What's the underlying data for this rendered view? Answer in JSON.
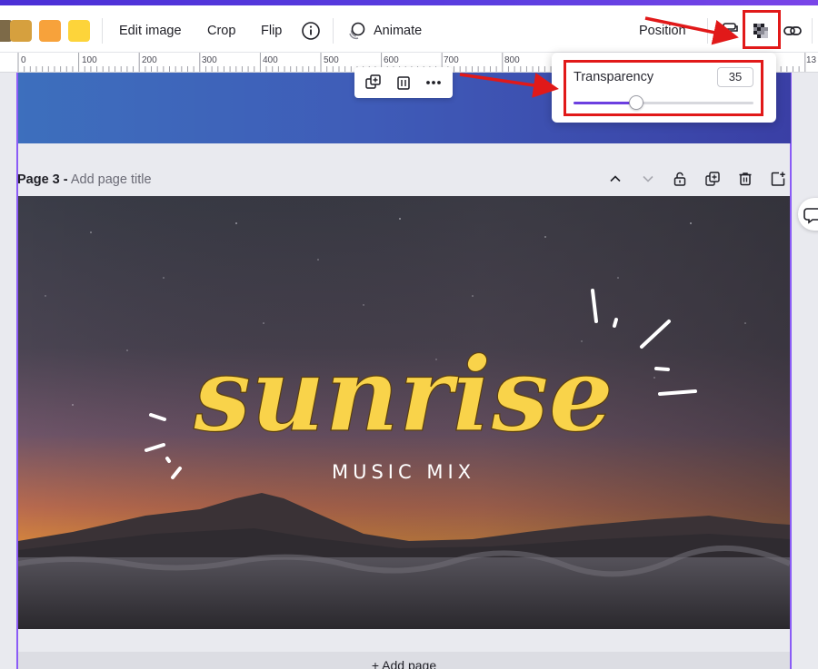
{
  "toolbar": {
    "swatches": [
      "#d6a03e",
      "#f7a23b",
      "#fdd43a"
    ],
    "edit_image": "Edit image",
    "crop": "Crop",
    "flip": "Flip",
    "animate": "Animate",
    "position": "Position",
    "icons": [
      "info-icon",
      "animate-icon",
      "paint-roller-icon",
      "transparency-icon",
      "link-icon"
    ]
  },
  "ruler": {
    "labels": [
      "0",
      "100",
      "200",
      "300",
      "400",
      "500",
      "600",
      "700",
      "800",
      "13"
    ]
  },
  "popup": {
    "label": "Transparency",
    "value": "35",
    "slider_fraction": 0.35
  },
  "page": {
    "number_label": "Page 3 -",
    "title_placeholder": "Add page title",
    "title_text": "sunrise",
    "subtitle_text": "MUSIC MIX",
    "title_color": "#f9d34a"
  },
  "footer": {
    "add_page": "+ Add page"
  },
  "colors": {
    "accent": "#8b5cf6",
    "annotation_red": "#e11919",
    "slider_purple": "#6c3fe0"
  }
}
